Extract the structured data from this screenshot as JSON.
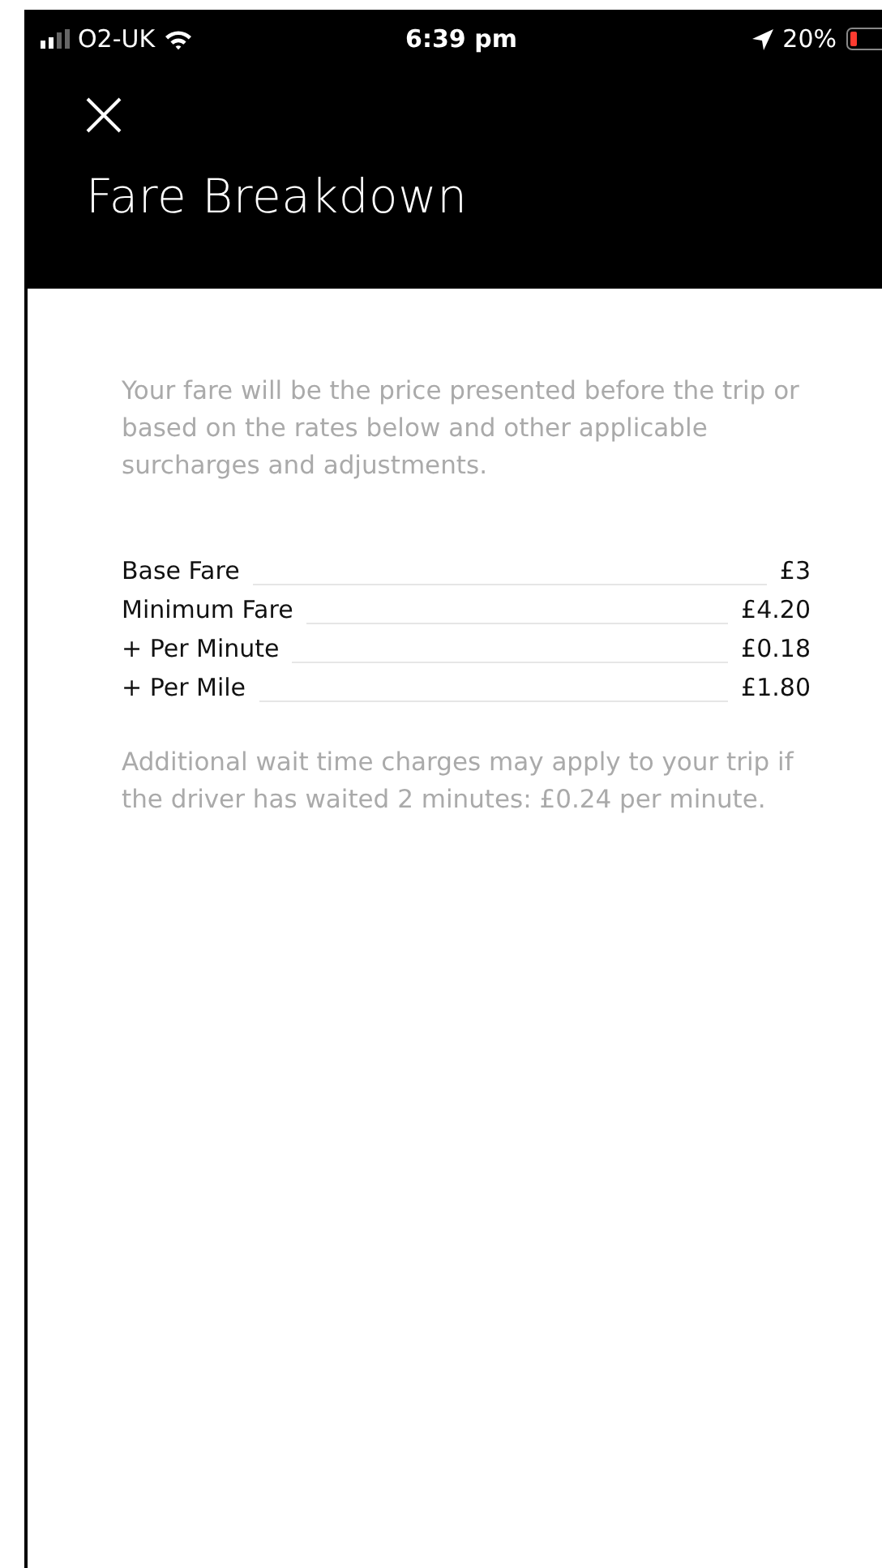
{
  "status_bar": {
    "carrier": "O2-UK",
    "time": "6:39 pm",
    "battery": "20%"
  },
  "header": {
    "title": "Fare Breakdown"
  },
  "intro": "Your fare will be the price presented before the trip or based on the rates below and other applicable surcharges and adjustments.",
  "rates": [
    {
      "label": "Base Fare",
      "amount": "£3"
    },
    {
      "label": "Minimum Fare",
      "amount": "£4.20"
    },
    {
      "label": "+ Per Minute",
      "amount": "£0.18"
    },
    {
      "label": "+ Per Mile",
      "amount": "£1.80"
    }
  ],
  "note": "Additional wait time charges may apply to your trip if the driver has waited 2 minutes: £0.24 per minute."
}
